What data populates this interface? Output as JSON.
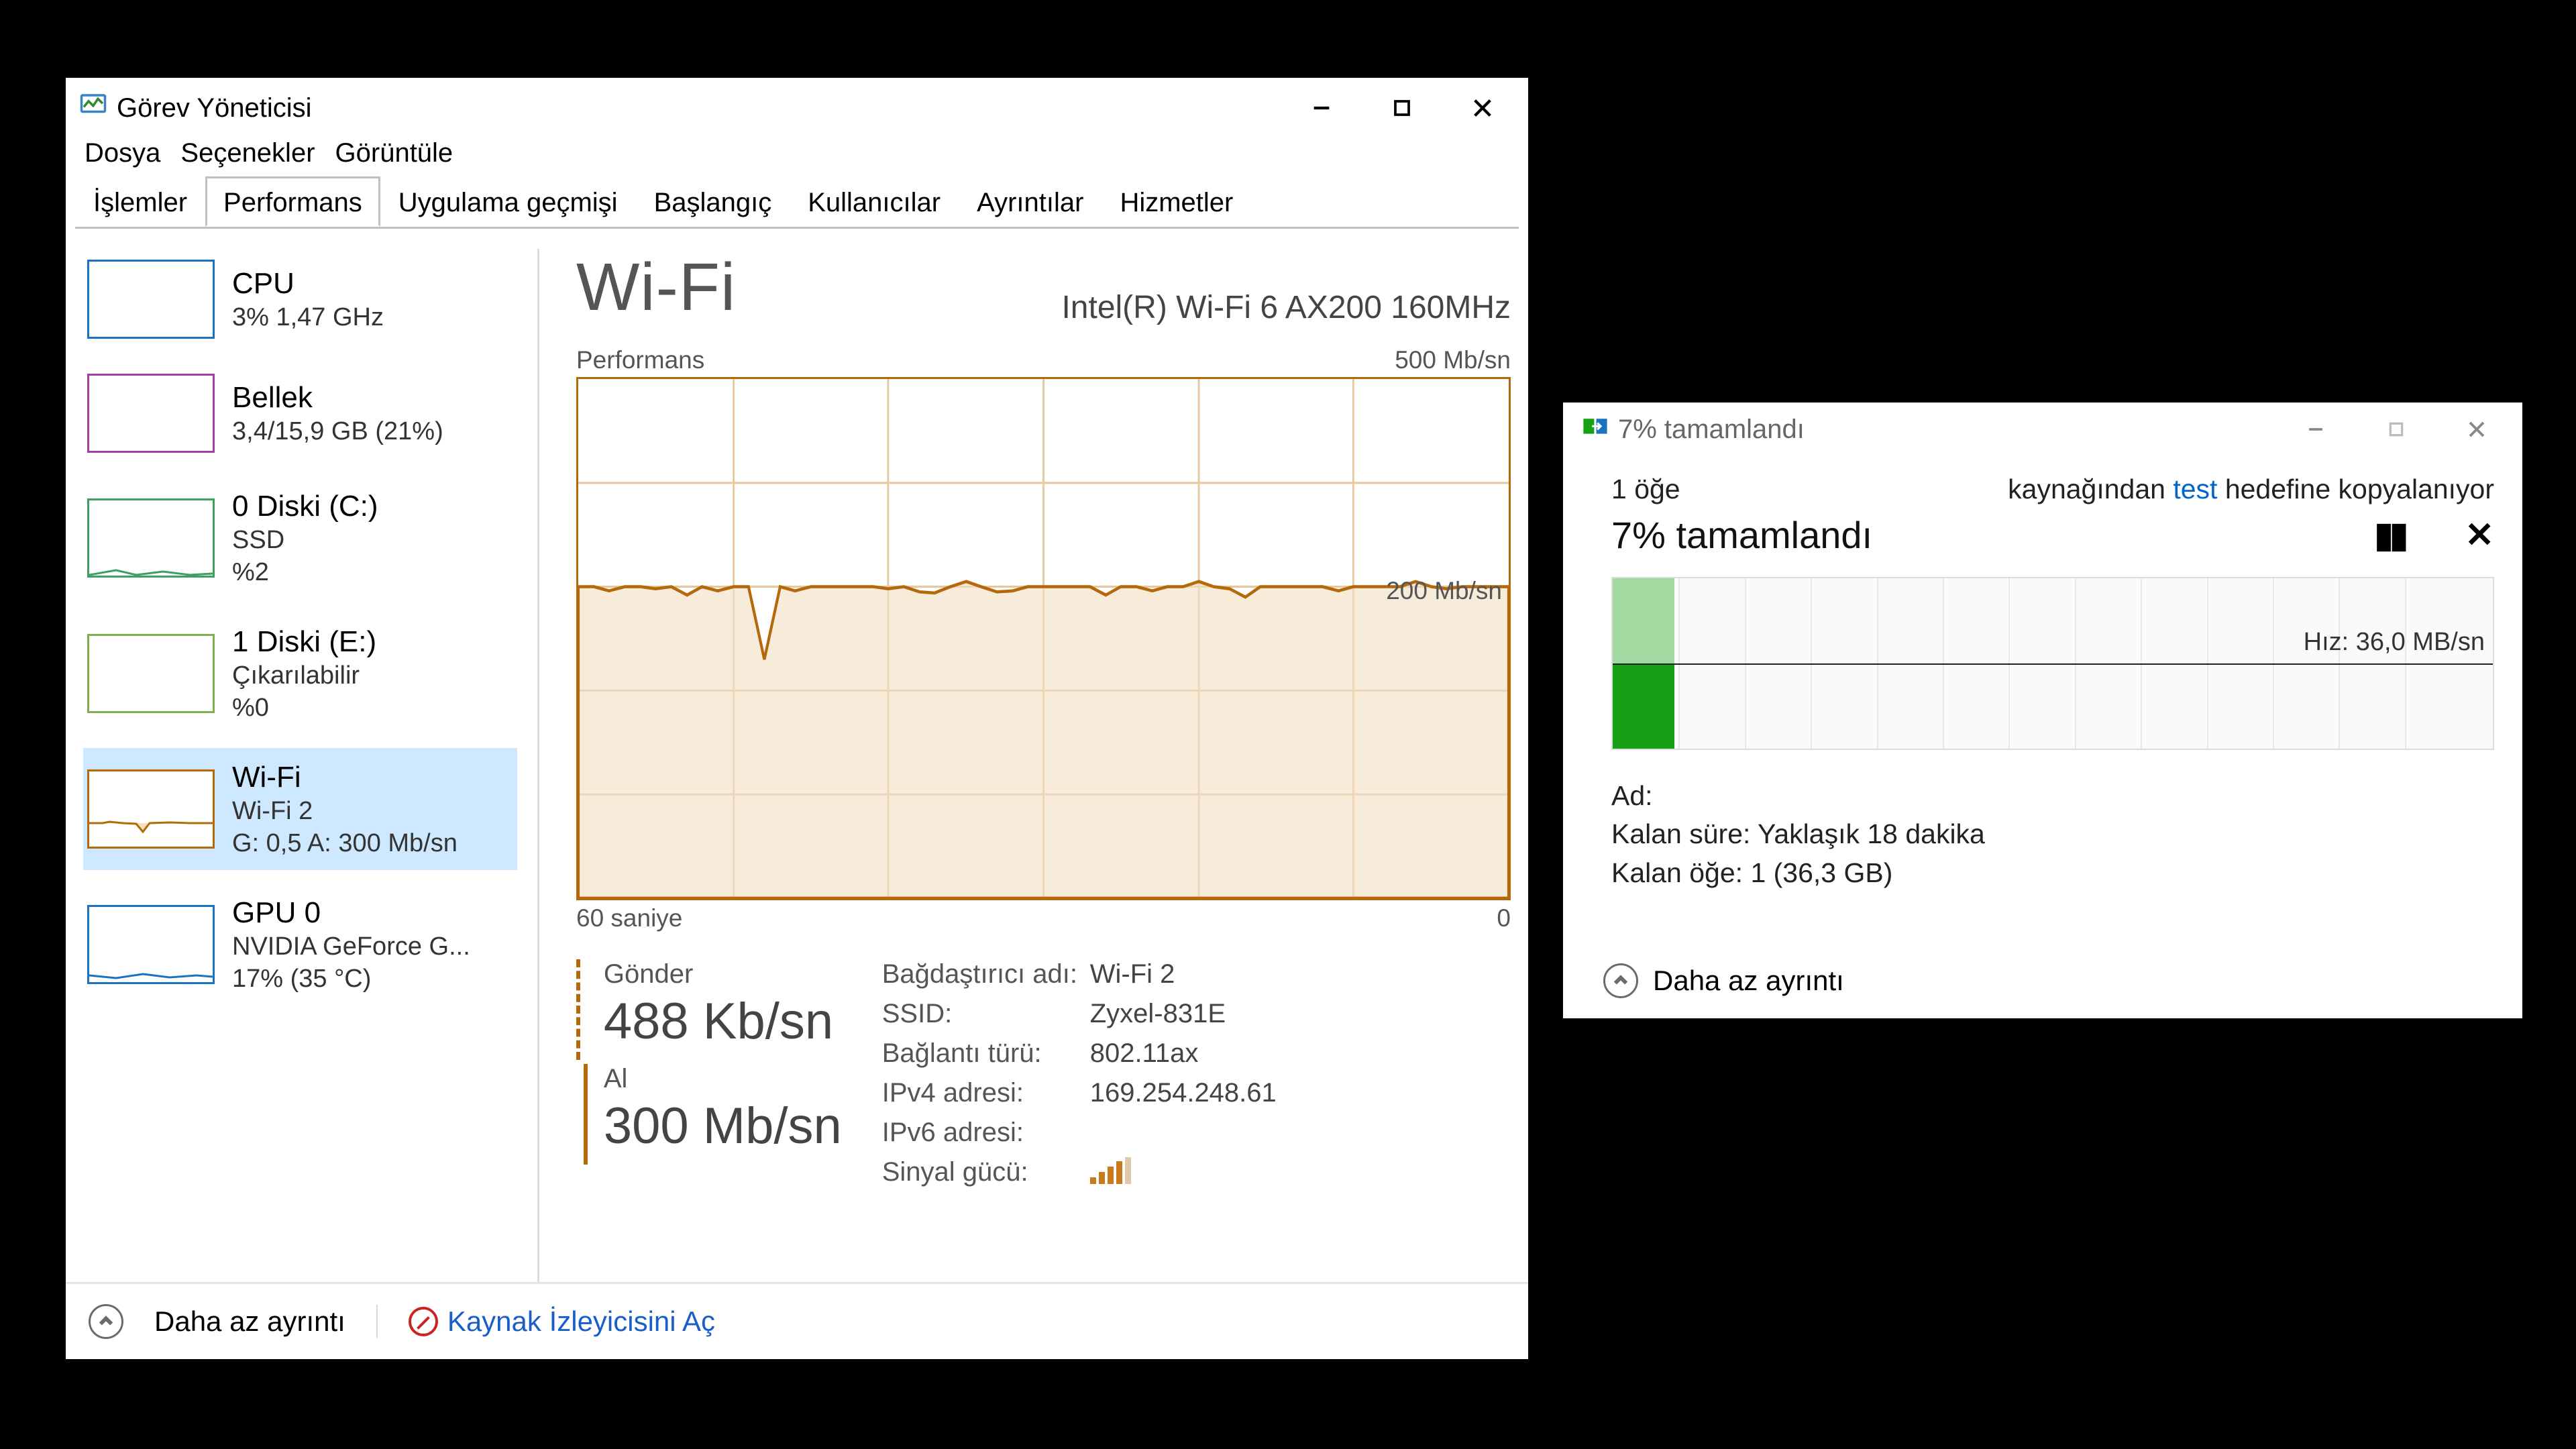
{
  "task_manager": {
    "title": "Görev Yöneticisi",
    "menu": {
      "file": "Dosya",
      "options": "Seçenekler",
      "view": "Görüntüle"
    },
    "tabs": {
      "processes": "İşlemler",
      "performance": "Performans",
      "app_history": "Uygulama geçmişi",
      "startup": "Başlangıç",
      "users": "Kullanıcılar",
      "details": "Ayrıntılar",
      "services": "Hizmetler"
    },
    "sidebar": {
      "cpu": {
        "title": "CPU",
        "sub": "3%  1,47 GHz"
      },
      "mem": {
        "title": "Bellek",
        "sub": "3,4/15,9 GB (21%)"
      },
      "disk0": {
        "title": "0 Diski (C:)",
        "sub": "SSD",
        "sub2": "%2"
      },
      "disk1": {
        "title": "1 Diski (E:)",
        "sub": "Çıkarılabilir",
        "sub2": "%0"
      },
      "wifi": {
        "title": "Wi-Fi",
        "sub": "Wi-Fi 2",
        "sub2": "G: 0,5 A: 300 Mb/sn"
      },
      "gpu": {
        "title": "GPU 0",
        "sub": "NVIDIA GeForce G...",
        "sub2": "17% (35 °C)"
      }
    },
    "panel": {
      "title": "Wi-Fi",
      "device": "Intel(R) Wi-Fi 6 AX200 160MHz",
      "chart_title": "Performans",
      "chart_max": "500 Mb/sn",
      "chart_200": "200 Mb/sn",
      "x_left": "60 saniye",
      "x_right": "0",
      "send_label": "Gönder",
      "send_value": "488 Kb/sn",
      "recv_label": "Al",
      "recv_value": "300 Mb/sn",
      "kv": {
        "adapter_k": "Bağdaştırıcı adı:",
        "adapter_v": "Wi-Fi 2",
        "ssid_k": "SSID:",
        "ssid_v": "Zyxel-831E",
        "conn_k": "Bağlantı türü:",
        "conn_v": "802.11ax",
        "ipv4_k": "IPv4 adresi:",
        "ipv4_v": "169.254.248.61",
        "ipv6_k": "IPv6 adresi:",
        "ipv6_v": "",
        "signal_k": "Sinyal gücü:"
      }
    },
    "footer": {
      "fewer": "Daha az ayrıntı",
      "open_resmon": "Kaynak İzleyicisini Aç"
    }
  },
  "copy_dialog": {
    "title": "7%  tamamlandı",
    "item_count": "1 öğe",
    "src_prefix": "kaynağından ",
    "src_link": "test",
    "src_suffix": " hedefine kopyalanıyor",
    "progress_title": "7%  tamamlandı",
    "speed": "Hız: 36,0 MB/sn",
    "name_label": "Ad:",
    "time_label": "Kalan süre:  Yaklaşık 18 dakika",
    "left_label": "Kalan öğe:  1 (36,3 GB)",
    "fewer": "Daha az ayrıntı",
    "progress_pct_css": "7%"
  },
  "chart_data": {
    "type": "line",
    "title": "Wi-Fi Performans",
    "xlabel": "saniye",
    "ylabel": "Mb/sn",
    "ylim": [
      0,
      500
    ],
    "x_range_seconds": [
      60,
      0
    ],
    "series": [
      {
        "name": "Al (receive)",
        "values": [
          300,
          300,
          296,
          300,
          300,
          298,
          300,
          292,
          300,
          296,
          300,
          300,
          230,
          300,
          296,
          300,
          300,
          300,
          300,
          300,
          298,
          300,
          295,
          294,
          300,
          305,
          300,
          295,
          296,
          300,
          300,
          300,
          300,
          300,
          292,
          300,
          300,
          296,
          300,
          300,
          305,
          300,
          298,
          290,
          300,
          300,
          300,
          300,
          300,
          296,
          300,
          300,
          300,
          300,
          305,
          300,
          298,
          300,
          300,
          300
        ]
      }
    ],
    "sidebar_sparklines": {
      "cpu_pct": 3,
      "mem_pct": 21,
      "disk0_pct": 2,
      "disk1_pct": 0,
      "wifi_recv_mbps": 300,
      "gpu_pct": 17
    }
  }
}
